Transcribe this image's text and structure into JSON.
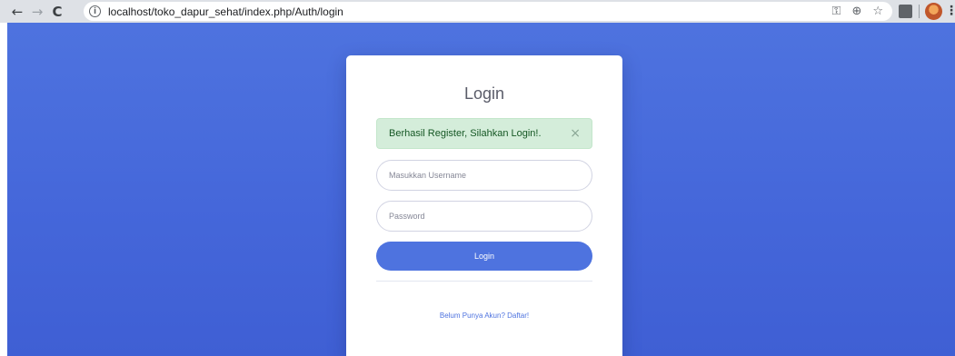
{
  "browser": {
    "url": "localhost/toko_dapur_sehat/index.php/Auth/login",
    "info_glyph": "i",
    "back_glyph": "←",
    "forward_glyph": "→",
    "reload_glyph": "C",
    "key_glyph": "⚿",
    "zoom_glyph": "⊕",
    "star_glyph": "☆",
    "menu_glyph": "⋮"
  },
  "login_card": {
    "title": "Login",
    "alert": {
      "message": "Berhasil Register, Silahkan Login!.",
      "close_glyph": "×"
    },
    "username_placeholder": "Masukkan Username",
    "password_placeholder": "Password",
    "submit_label": "Login",
    "register_link": "Belum Punya Akun? Daftar!"
  },
  "colors": {
    "primary": "#4e73df",
    "alert_bg": "#d4edda",
    "alert_text": "#155724"
  }
}
